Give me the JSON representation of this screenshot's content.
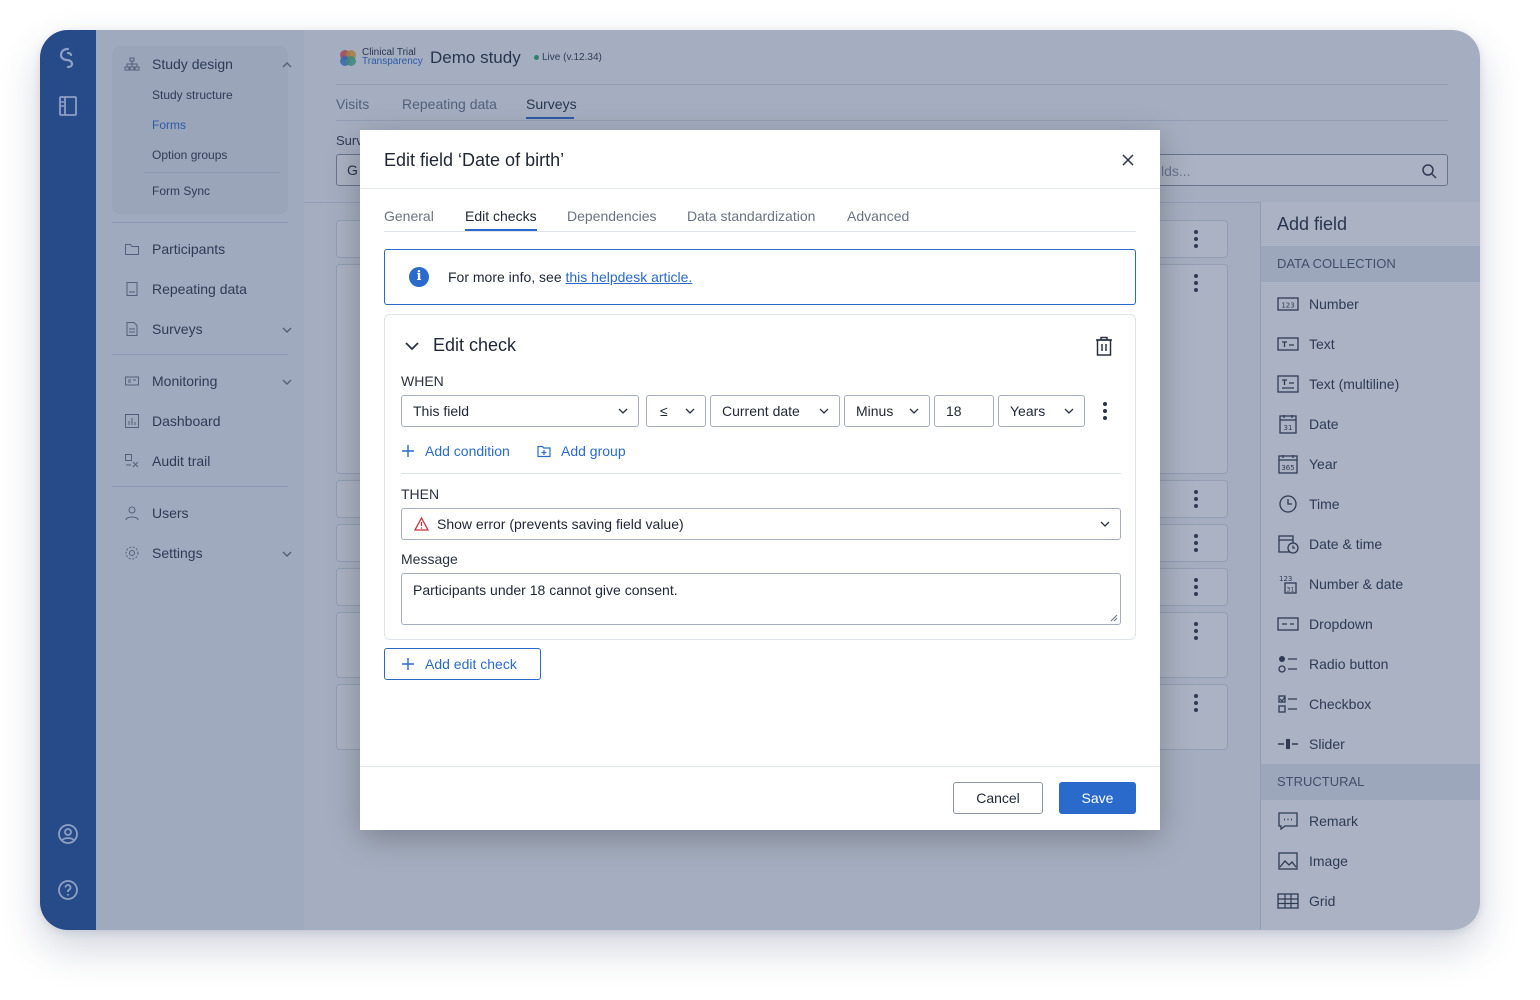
{
  "app": {
    "logo_line1": "Clinical Trial",
    "logo_line2": "Transparency",
    "study_title": "Demo study",
    "status": "Live (v.12.34)"
  },
  "sidebar": {
    "study_design": "Study design",
    "sub_items": [
      "Study structure",
      "Forms",
      "Option groups",
      "Form Sync"
    ],
    "items": [
      "Participants",
      "Repeating data",
      "Surveys",
      "Monitoring",
      "Dashboard",
      "Audit trail",
      "Users",
      "Settings"
    ]
  },
  "top_tabs": [
    "Visits",
    "Repeating data",
    "Surveys"
  ],
  "background": {
    "survey_label_partial": "Surv",
    "survey_select_partial": "G",
    "search_placeholder_partial": "lds..."
  },
  "right_panel": {
    "title": "Add field",
    "section_data": "DATA COLLECTION",
    "data_items": [
      "Number",
      "Text",
      "Text (multiline)",
      "Date",
      "Year",
      "Time",
      "Date & time",
      "Number & date",
      "Dropdown",
      "Radio button",
      "Checkbox",
      "Slider"
    ],
    "section_structural": "STRUCTURAL",
    "structural_items": [
      "Remark",
      "Image",
      "Grid"
    ]
  },
  "modal": {
    "title": "Edit field ‘Date of birth’",
    "tabs": [
      "General",
      "Edit checks",
      "Dependencies",
      "Data standardization",
      "Advanced"
    ],
    "active_tab": "Edit checks",
    "info_text": "For more info, see ",
    "info_link": "this helpdesk article.",
    "edit_check": {
      "title": "Edit check",
      "when_label": "WHEN",
      "condition": {
        "field": "This field",
        "operator": "≤",
        "reference": "Current date",
        "modifier": "Minus",
        "amount": "18",
        "unit": "Years"
      },
      "add_condition": "Add condition",
      "add_group": "Add group",
      "then_label": "THEN",
      "action": "Show error (prevents saving field value)",
      "message_label": "Message",
      "message": "Participants under 18 cannot give consent."
    },
    "add_edit_check": "Add edit check",
    "cancel": "Cancel",
    "save": "Save"
  },
  "colors": {
    "primary": "#2a6acb",
    "rail": "#1e4f9c",
    "error": "#c8323c"
  }
}
